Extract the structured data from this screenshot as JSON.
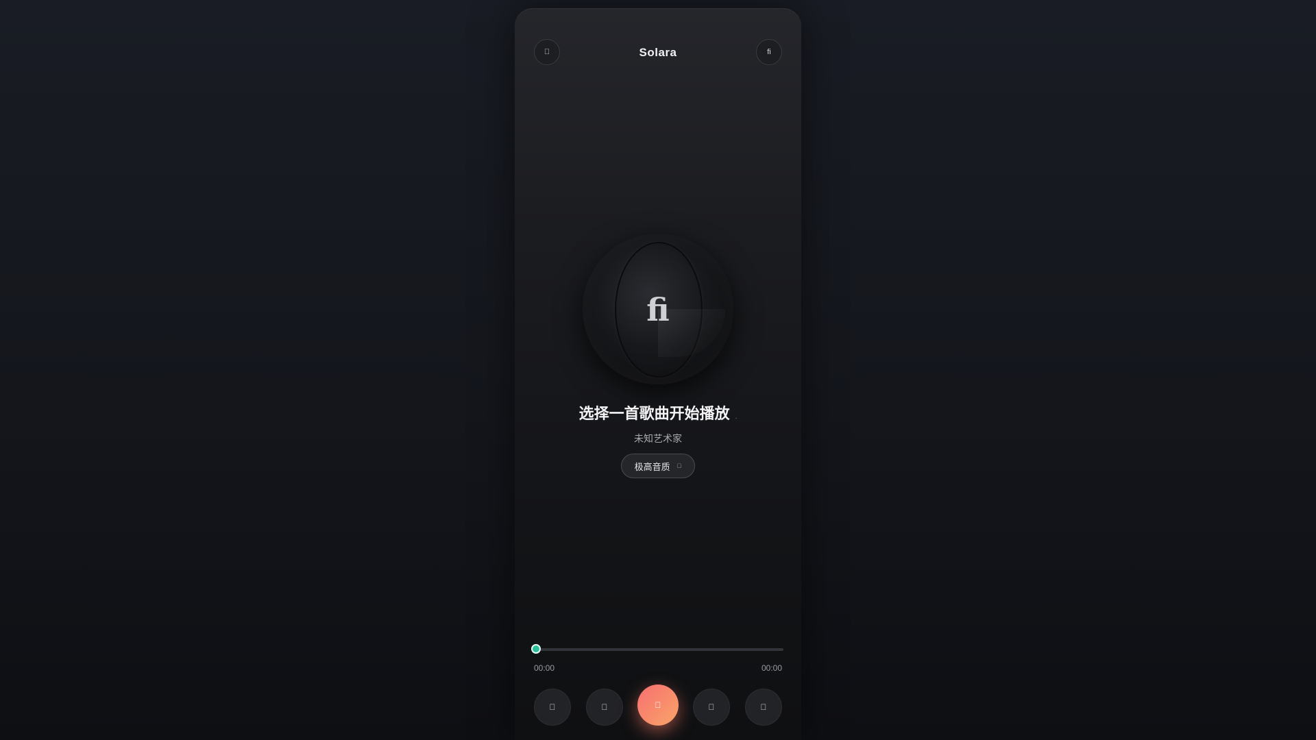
{
  "app": {
    "title": "Solara"
  },
  "header": {
    "left_button_icon": "",
    "right_button_icon": "ﬁ"
  },
  "disc": {
    "icon_glyph": "ﬁ"
  },
  "track": {
    "title": "选择一首歌曲开始播放",
    "title_marker": ".",
    "artist": "未知艺术家"
  },
  "quality": {
    "label": "极高音质",
    "chevron_glyph": ""
  },
  "progress": {
    "value": 0,
    "current_time": "00:00",
    "duration": "00:00"
  },
  "controls": {
    "mode_glyph": "",
    "prev_glyph": "",
    "play_glyph": "",
    "next_glyph": "",
    "playlist_glyph": ""
  },
  "colors": {
    "accent_play_start": "#f76f6f",
    "accent_play_end": "#f8a56a",
    "progress_knob": "#2bbf9c"
  }
}
